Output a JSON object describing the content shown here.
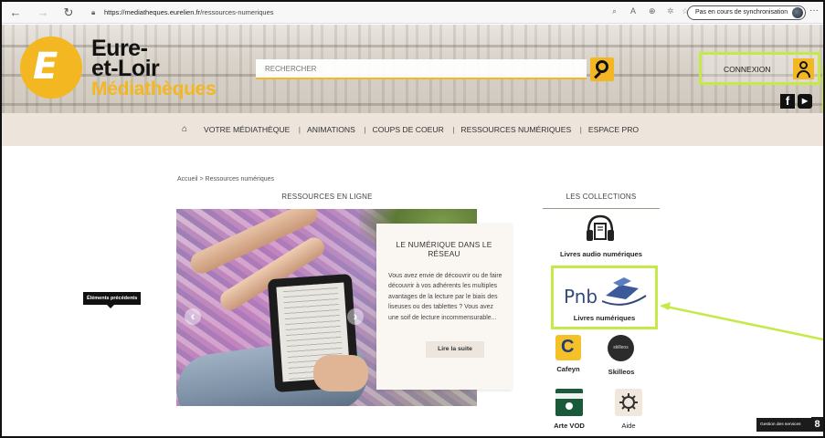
{
  "browser": {
    "url_host": "https://mediatheques.eurelien.fr",
    "url_path": "/ressources-numeriques",
    "sync_label": "Pas en cours de synchronisation",
    "more_label": "···"
  },
  "header": {
    "brand_line1": "Eure-",
    "brand_line2": "et-Loir",
    "brand_line3": "Médiathèques",
    "search_placeholder": "RECHERCHER",
    "login_label": "CONNEXION",
    "facebook_glyph": "f",
    "youtube_glyph": "▶"
  },
  "nav": {
    "items": [
      "VOTRE MÉDIATHÈQUE",
      "ANIMATIONS",
      "COUPS DE COEUR",
      "RESSOURCES NUMÉRIQUES",
      "ESPACE PRO"
    ]
  },
  "breadcrumb": "Accueil > Ressources numériques",
  "sections": {
    "left_title": "RESSOURCES EN LIGNE",
    "right_title": "LES COLLECTIONS"
  },
  "card": {
    "title": "LE NUMÉRIQUE DANS LE RÉSEAU",
    "text": "Vous avez envie de découvrir ou de faire découvrir à vos adhérents les multiples avantages de la lecture par le biais des liseuses ou des tablettes ? Vous avez une soif de lecture incommensurable...",
    "button": "Lire la suite"
  },
  "collections": {
    "audio": "Livres audio numériques",
    "pnb_logo": "Pnb",
    "pnb": "Livres numériques",
    "cafeyn": "Cafeyn",
    "skilleos": "Skilleos",
    "skilleos_logo": "skilleos",
    "arte": "Arte VOD",
    "aide": "Aide"
  },
  "tooltip": "Éléments précédents",
  "cookie": {
    "label": "Gestion des services",
    "number": "8"
  },
  "colors": {
    "brand_yellow": "#f3b721",
    "highlight_green": "#c6e94a",
    "nav_bg": "#ede4db"
  }
}
